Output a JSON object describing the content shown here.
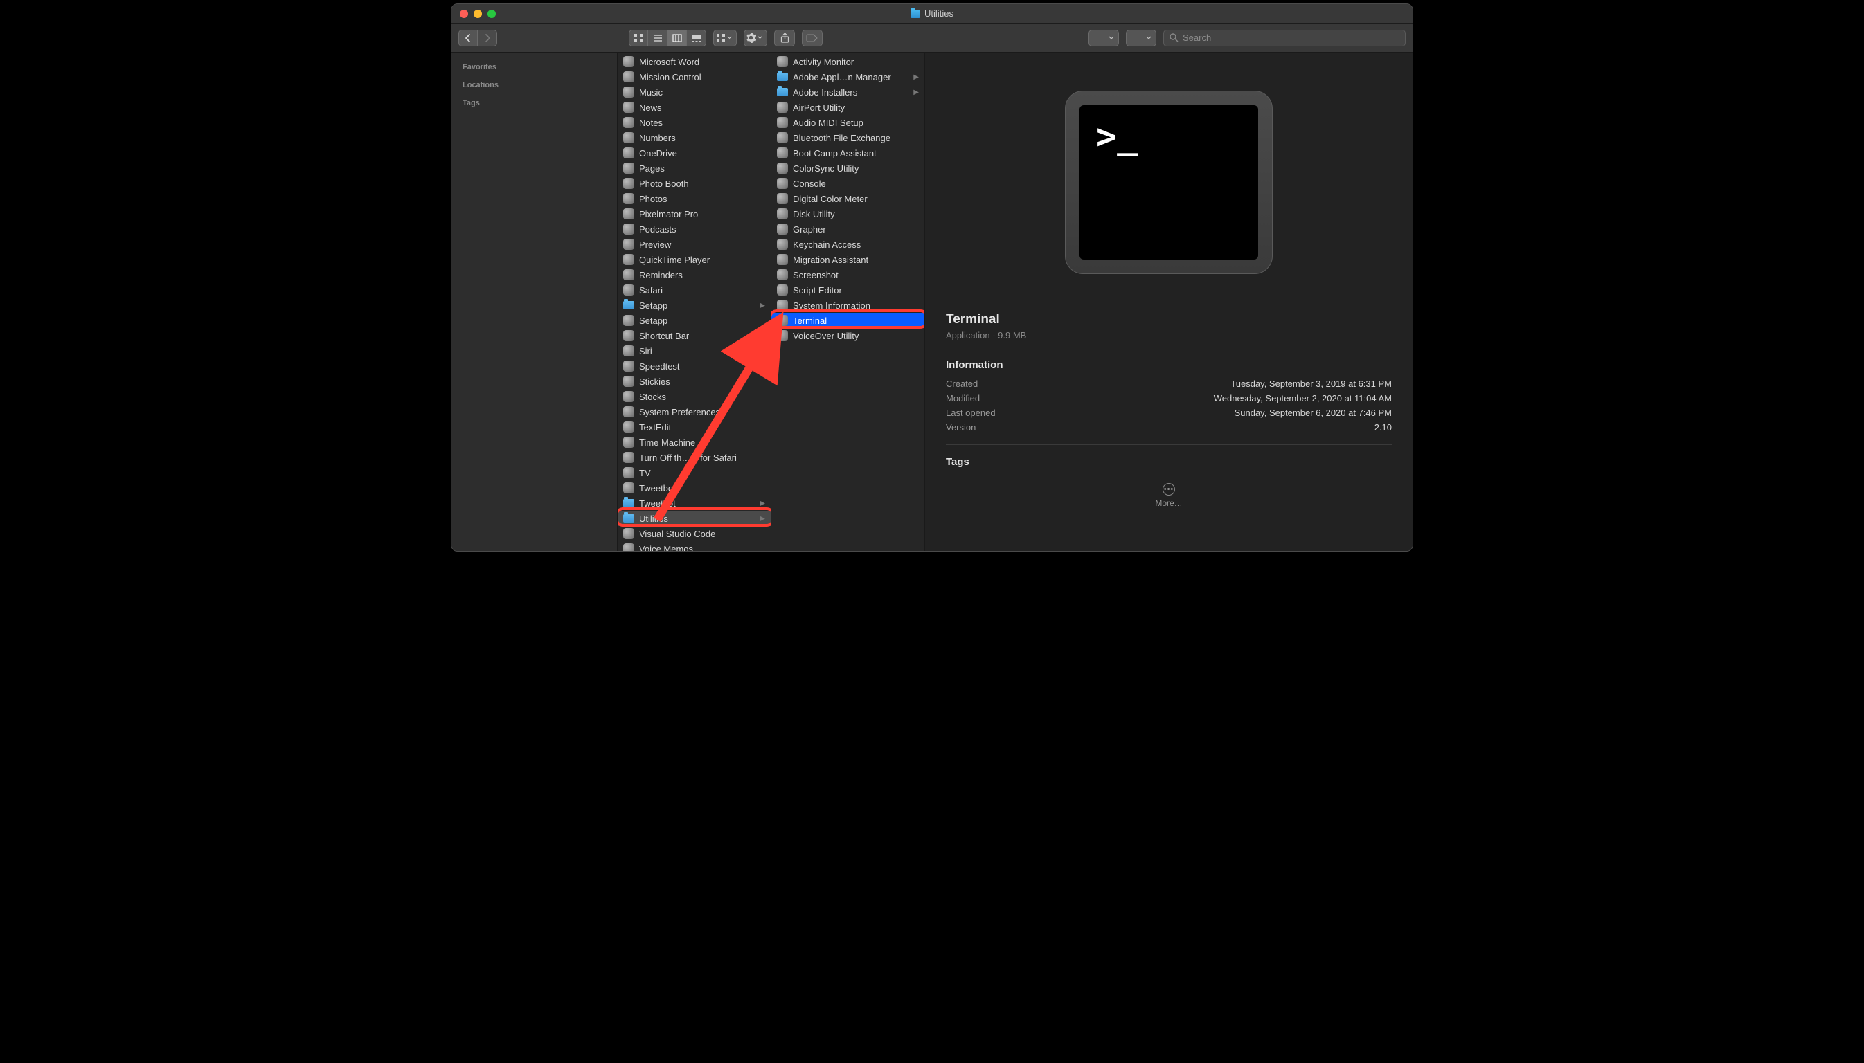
{
  "window": {
    "title": "Utilities"
  },
  "search": {
    "placeholder": "Search"
  },
  "sidebar": {
    "sections": [
      {
        "label": "Favorites"
      },
      {
        "label": "Locations"
      },
      {
        "label": "Tags"
      }
    ]
  },
  "col1": [
    {
      "label": "Microsoft Word",
      "kind": "app"
    },
    {
      "label": "Mission Control",
      "kind": "app"
    },
    {
      "label": "Music",
      "kind": "app"
    },
    {
      "label": "News",
      "kind": "app"
    },
    {
      "label": "Notes",
      "kind": "app"
    },
    {
      "label": "Numbers",
      "kind": "app"
    },
    {
      "label": "OneDrive",
      "kind": "app"
    },
    {
      "label": "Pages",
      "kind": "app"
    },
    {
      "label": "Photo Booth",
      "kind": "app"
    },
    {
      "label": "Photos",
      "kind": "app"
    },
    {
      "label": "Pixelmator Pro",
      "kind": "app"
    },
    {
      "label": "Podcasts",
      "kind": "app"
    },
    {
      "label": "Preview",
      "kind": "app"
    },
    {
      "label": "QuickTime Player",
      "kind": "app"
    },
    {
      "label": "Reminders",
      "kind": "app"
    },
    {
      "label": "Safari",
      "kind": "app"
    },
    {
      "label": "Setapp",
      "kind": "folder",
      "children": true
    },
    {
      "label": "Setapp",
      "kind": "app"
    },
    {
      "label": "Shortcut Bar",
      "kind": "app"
    },
    {
      "label": "Siri",
      "kind": "app"
    },
    {
      "label": "Speedtest",
      "kind": "app"
    },
    {
      "label": "Stickies",
      "kind": "app"
    },
    {
      "label": "Stocks",
      "kind": "app"
    },
    {
      "label": "System Preferences",
      "kind": "app"
    },
    {
      "label": "TextEdit",
      "kind": "app"
    },
    {
      "label": "Time Machine",
      "kind": "app"
    },
    {
      "label": "Turn Off th…ts for Safari",
      "kind": "app"
    },
    {
      "label": "TV",
      "kind": "app"
    },
    {
      "label": "Tweetbot",
      "kind": "app"
    },
    {
      "label": "Tweetbot",
      "kind": "folder",
      "children": true
    },
    {
      "label": "Utilities",
      "kind": "folder",
      "children": true,
      "selected": "gray",
      "highlight": true
    },
    {
      "label": "Visual Studio Code",
      "kind": "app"
    },
    {
      "label": "Voice Memos",
      "kind": "app"
    }
  ],
  "col2": [
    {
      "label": "Activity Monitor",
      "kind": "app"
    },
    {
      "label": "Adobe Appl…n Manager",
      "kind": "folder",
      "children": true
    },
    {
      "label": "Adobe Installers",
      "kind": "folder",
      "children": true
    },
    {
      "label": "AirPort Utility",
      "kind": "app"
    },
    {
      "label": "Audio MIDI Setup",
      "kind": "app"
    },
    {
      "label": "Bluetooth File Exchange",
      "kind": "app"
    },
    {
      "label": "Boot Camp Assistant",
      "kind": "app"
    },
    {
      "label": "ColorSync Utility",
      "kind": "app"
    },
    {
      "label": "Console",
      "kind": "app"
    },
    {
      "label": "Digital Color Meter",
      "kind": "app"
    },
    {
      "label": "Disk Utility",
      "kind": "app"
    },
    {
      "label": "Grapher",
      "kind": "app"
    },
    {
      "label": "Keychain Access",
      "kind": "app"
    },
    {
      "label": "Migration Assistant",
      "kind": "app"
    },
    {
      "label": "Screenshot",
      "kind": "app"
    },
    {
      "label": "Script Editor",
      "kind": "app"
    },
    {
      "label": "System Information",
      "kind": "app"
    },
    {
      "label": "Terminal",
      "kind": "app",
      "selected": "blue",
      "highlight": true
    },
    {
      "label": "VoiceOver Utility",
      "kind": "app"
    }
  ],
  "preview": {
    "name": "Terminal",
    "subtitle": "Application - 9.9 MB",
    "section_info": "Information",
    "rows": [
      {
        "k": "Created",
        "v": "Tuesday, September 3, 2019 at 6:31 PM"
      },
      {
        "k": "Modified",
        "v": "Wednesday, September 2, 2020 at 11:04 AM"
      },
      {
        "k": "Last opened",
        "v": "Sunday, September 6, 2020 at 7:46 PM"
      },
      {
        "k": "Version",
        "v": "2.10"
      }
    ],
    "section_tags": "Tags",
    "more_label": "More…"
  }
}
